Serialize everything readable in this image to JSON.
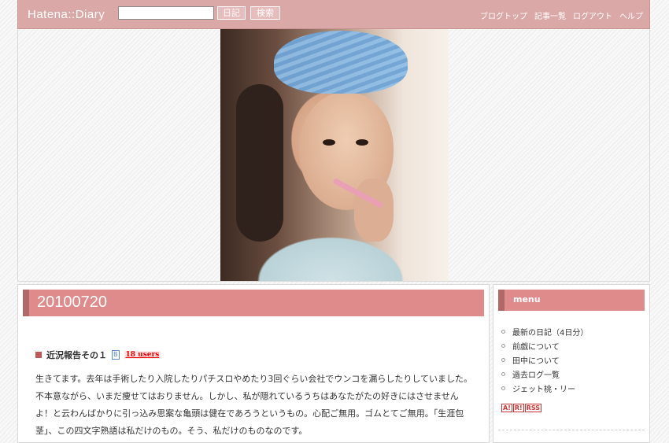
{
  "header": {
    "logo": "Hatena::Diary",
    "search_value": "",
    "diary_button": "日記",
    "search_button": "検索",
    "nav": [
      "ブログトップ",
      "記事一覧",
      "ログアウト",
      "ヘルプ"
    ]
  },
  "entry": {
    "date": "20100720",
    "title": "近況報告その１",
    "bookmark_icon": "B",
    "users_badge": "18 users",
    "body": "生きてます。去年は手術したり入院したりパチスロやめたり3回ぐらい会社でウンコを漏らしたりしていました。不本意ながら、いまだ痩せてはおりません。しかし、私が隠れているうちはあなたがたの好きにはさせませんよ！と云わんばかりに引っ込み思案な亀頭は健在であろうというもの。心配ご無用。ゴムとてご無用。「生涯包茎」、この四文字熟語は私だけのもの。そう、私だけのものなのです。"
  },
  "sidebar": {
    "title": "menu",
    "items": [
      "最新の日記（4日分）",
      "前戯について",
      "田中について",
      "過去ログ一覧",
      "ジェット桃・リー"
    ],
    "feed_icons": [
      "A!",
      "R!",
      "RSS"
    ]
  },
  "colors": {
    "topbar": "#dba8a8",
    "section_header": "#e08b8b",
    "section_accent": "#b06868",
    "badge": "#ee0000"
  },
  "icons": {
    "bullet": "square-bullet-icon",
    "bookmark": "hatena-bookmark-icon"
  }
}
